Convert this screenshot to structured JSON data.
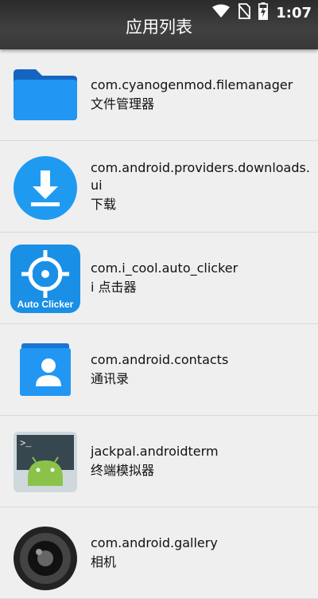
{
  "status_bar": {
    "time": "1:07",
    "icons": [
      "wifi-icon",
      "no-sim-icon",
      "battery-charging-icon"
    ]
  },
  "app_bar": {
    "title": "应用列表"
  },
  "apps": [
    {
      "package": "com.cyanogenmod.filemanager",
      "name": "文件管理器",
      "icon": "folder-icon",
      "color": "#1e88e5"
    },
    {
      "package": "com.android.providers.downloads.ui",
      "name": "下载",
      "icon": "download-icon",
      "color": "#1e9bf0"
    },
    {
      "package": "com.i_cool.auto_clicker",
      "name": "i 点击器",
      "icon": "crosshair-icon",
      "icon_text": "Auto Clicker",
      "color": "#1a8fe6"
    },
    {
      "package": "com.android.contacts",
      "name": "通讯录",
      "icon": "contacts-icon",
      "color": "#2196f3"
    },
    {
      "package": "jackpal.androidterm",
      "name": "终端模拟器",
      "icon": "terminal-android-icon",
      "color": "#8bc34a"
    },
    {
      "package": "com.android.gallery",
      "name": "相机",
      "icon": "camera-lens-icon",
      "color": "#333333"
    }
  ]
}
